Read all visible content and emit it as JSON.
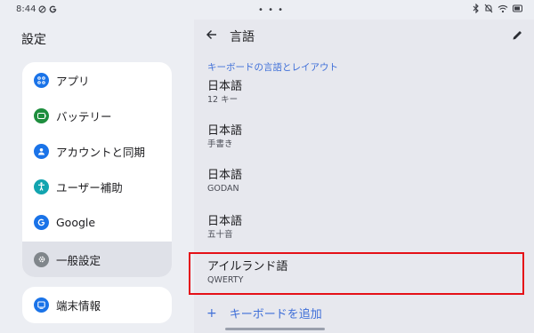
{
  "status": {
    "time": "8:44",
    "dots": "• • •"
  },
  "left": {
    "title": "設定",
    "items": [
      {
        "label": "アプリ",
        "icon": "apps-icon",
        "color": "#1a73e8"
      },
      {
        "label": "バッテリー",
        "icon": "battery-icon",
        "color": "#1e8e3e"
      },
      {
        "label": "アカウントと同期",
        "icon": "account-icon",
        "color": "#1a73e8"
      },
      {
        "label": "ユーザー補助",
        "icon": "accessibility-icon",
        "color": "#12a4af"
      },
      {
        "label": "Google",
        "icon": "google-icon",
        "color": "#1a73e8"
      },
      {
        "label": "一般設定",
        "icon": "gear-icon",
        "color": "#80868b"
      }
    ],
    "device": {
      "label": "端末情報",
      "icon": "device-info-icon",
      "color": "#1a73e8"
    }
  },
  "right": {
    "title": "言語",
    "section": "キーボードの言語とレイアウト",
    "languages": [
      {
        "name": "日本語",
        "layout": "12 キー"
      },
      {
        "name": "日本語",
        "layout": "手書き"
      },
      {
        "name": "日本語",
        "layout": "GODAN"
      },
      {
        "name": "日本語",
        "layout": "五十音"
      },
      {
        "name": "アイルランド語",
        "layout": "QWERTY"
      }
    ],
    "add": {
      "plus": "+",
      "label": "キーボードを追加"
    }
  }
}
